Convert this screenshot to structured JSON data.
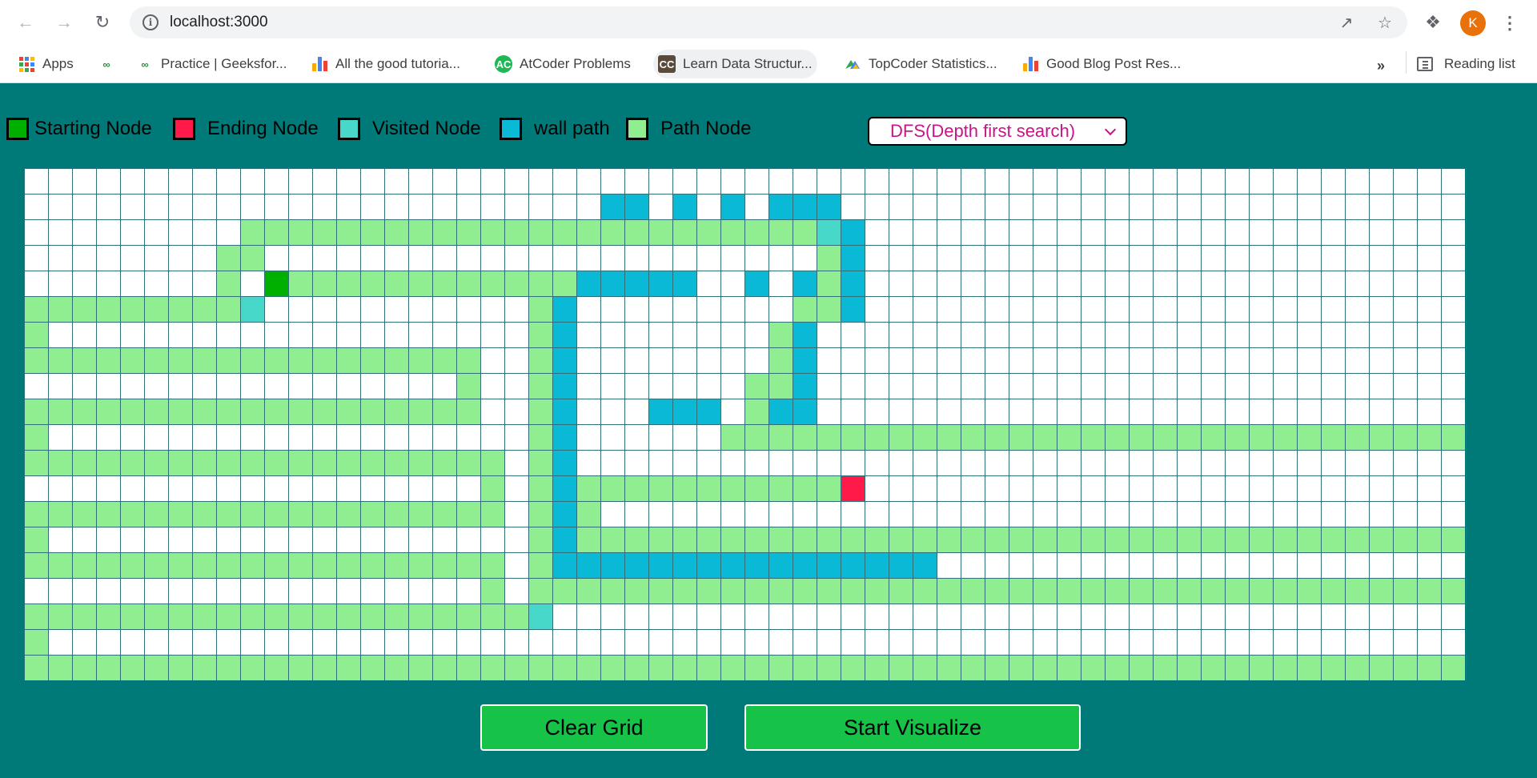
{
  "browser": {
    "url": "localhost:3000",
    "avatar_letter": "K",
    "bookmarks": [
      {
        "label": "Apps",
        "icon": "apps-grid-icon"
      },
      {
        "label": "",
        "icon": "geeksforgeeks-icon"
      },
      {
        "label": "Practice | Geeksfor...",
        "icon": "geeksforgeeks-icon"
      },
      {
        "label": "All the good tutoria...",
        "icon": "bar-chart-icon"
      },
      {
        "label": "AtCoder Problems",
        "icon": "atcoder-icon"
      },
      {
        "label": "Learn Data Structur...",
        "icon": "codechef-icon"
      },
      {
        "label": "TopCoder Statistics...",
        "icon": "topcoder-icon"
      },
      {
        "label": "Good Blog Post Res...",
        "icon": "bar-chart-icon"
      }
    ],
    "overflow_label": "»",
    "reading_list_label": "Reading list"
  },
  "legend": [
    {
      "label": "Starting Node",
      "color": "#00b000"
    },
    {
      "label": "Ending Node",
      "color": "#ff1a4a"
    },
    {
      "label": "Visited Node",
      "color": "#48d8c9"
    },
    {
      "label": "wall path",
      "color": "#0ab9d6"
    },
    {
      "label": "Path Node",
      "color": "#90ee90"
    }
  ],
  "algorithm_select": {
    "selected": "DFS(Depth first search)"
  },
  "colors": {
    "background": "#007a78",
    "path": "#90ee90",
    "wall": "#0ab9d6",
    "visited": "#48d8c9",
    "start": "#00b000",
    "end": "#ff1a4a",
    "button": "#16c248"
  },
  "grid": {
    "columns": 60,
    "rows_count": 20,
    "legend_codes": {
      ".": "empty",
      "p": "path",
      "w": "wall",
      "v": "visited",
      "s": "start",
      "e": "end"
    },
    "rows": [
      "............................................................",
      "........................ww.w.w.www..........................",
      ".........ppppppppppppppppppppppppvw.........................",
      "........pp.......................pw.........................",
      "........p.sppppppppppppwwwww..w.wpw.........................",
      "pppppppppv...........pw.........ppw.........................",
      "p....................pw........pw...........................",
      "ppppppppppppppppppp..pw........pw...........................",
      "..................p..pw.......ppw...........................",
      "ppppppppppppppppppp..pw...www.pww...........................",
      "p....................pw......ppppppppppppppppppppppppppppppp",
      "pppppppppppppppppppp.pw.....................................p",
      "...................p.pwpppppppppppe.........................p",
      "pppppppppppppppppppp.pwp....................................p",
      "p....................pwppppppppppppppppppppppppppppppppppppp",
      "pppppppppppppppppppp.pwwwwwwwwwwwwwwww......................",
      "...................p.pppppppppppppppppppppppppppppppppppppppp",
      "pppppppppppppppppppppv......................................p",
      "p...........................................................p",
      "pppppppppppppppppppppppppppppppppppppppppppppppppppppppppppp"
    ]
  },
  "buttons": {
    "clear_label": "Clear Grid",
    "start_label": "Start Visualize"
  }
}
